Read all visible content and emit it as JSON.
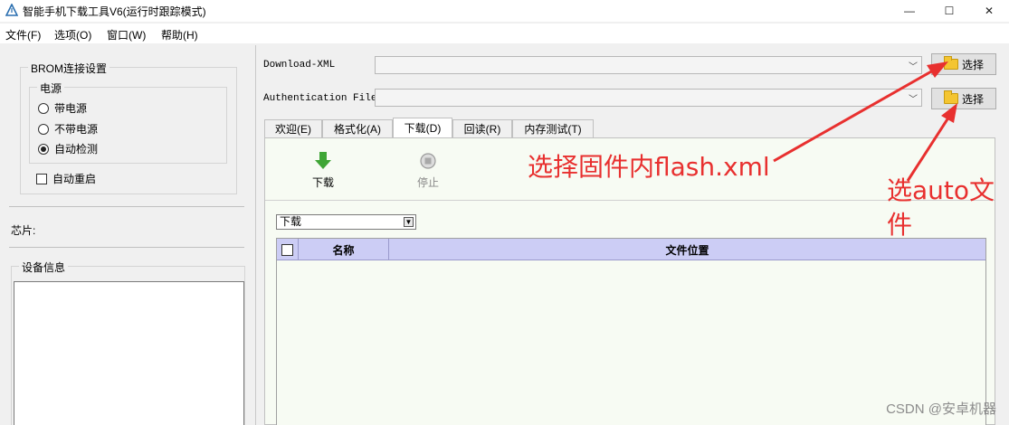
{
  "window": {
    "title": "智能手机下载工具V6(运行时跟踪模式)",
    "controls": {
      "minimize": "—",
      "maximize": "☐",
      "close": "✕"
    }
  },
  "menu": [
    "文件(F)",
    "选项(O)",
    "窗口(W)",
    "帮助(H)"
  ],
  "left": {
    "brom_group_title": "BROM连接设置",
    "power_group_title": "电源",
    "power_options": [
      {
        "label": "带电源",
        "checked": false
      },
      {
        "label": "不带电源",
        "checked": false
      },
      {
        "label": "自动检测",
        "checked": true
      }
    ],
    "auto_restart_label": "自动重启",
    "auto_restart_checked": false,
    "chip_label": "芯片:",
    "device_info_title": "设备信息"
  },
  "right": {
    "download_xml_label": "Download-XML",
    "download_xml_value": "",
    "auth_file_label": "Authentication File",
    "auth_file_value": "",
    "select_label": "选择",
    "tabs": [
      {
        "label": "欢迎(E)",
        "active": false
      },
      {
        "label": "格式化(A)",
        "active": false
      },
      {
        "label": "下载(D)",
        "active": true
      },
      {
        "label": "回读(R)",
        "active": false
      },
      {
        "label": "内存测试(T)",
        "active": false
      }
    ],
    "download_button": "下载",
    "stop_button": "停止",
    "mode_value": "下载",
    "table_headers": {
      "name": "名称",
      "location": "文件位置"
    }
  },
  "annotations": {
    "annotation_1": "选择固件内flash.xml",
    "annotation_2_line1": "选auto文",
    "annotation_2_line2": "件",
    "color": "#e8302f"
  },
  "watermark": "CSDN @安卓机器"
}
